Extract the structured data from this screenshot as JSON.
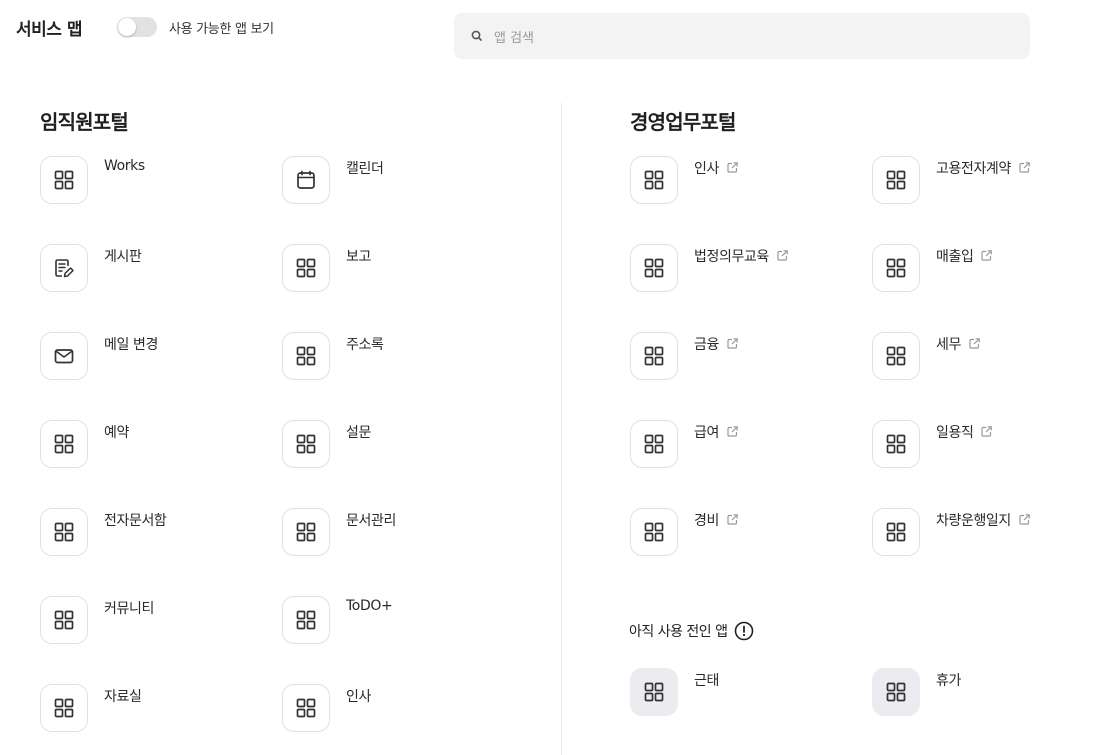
{
  "header": {
    "title": "서비스 맵",
    "toggle_label": "사용 가능한 앱 보기",
    "toggle_on": false,
    "search_placeholder": "앱 검색"
  },
  "left_section": {
    "title": "임직원포털",
    "apps": [
      {
        "label": "Works",
        "icon": "grid-icon"
      },
      {
        "label": "캘린더",
        "icon": "calendar-icon"
      },
      {
        "label": "게시판",
        "icon": "board-edit-icon"
      },
      {
        "label": "보고",
        "icon": "grid-icon"
      },
      {
        "label": "메일 변경",
        "icon": "mail-icon"
      },
      {
        "label": "주소록",
        "icon": "grid-icon"
      },
      {
        "label": "예약",
        "icon": "grid-icon"
      },
      {
        "label": "설문",
        "icon": "grid-icon"
      },
      {
        "label": "전자문서함",
        "icon": "grid-icon"
      },
      {
        "label": "문서관리",
        "icon": "grid-icon"
      },
      {
        "label": "커뮤니티",
        "icon": "grid-icon"
      },
      {
        "label": "ToDO+",
        "icon": "grid-icon"
      },
      {
        "label": "자료실",
        "icon": "grid-icon"
      },
      {
        "label": "인사",
        "icon": "grid-icon"
      }
    ]
  },
  "right_section": {
    "title": "경영업무포털",
    "apps": [
      {
        "label": "인사",
        "icon": "grid-icon",
        "external": true
      },
      {
        "label": "고용전자계약",
        "icon": "grid-icon",
        "external": true
      },
      {
        "label": "법정의무교육",
        "icon": "grid-icon",
        "external": true
      },
      {
        "label": "매출입",
        "icon": "grid-icon",
        "external": true
      },
      {
        "label": "금융",
        "icon": "grid-icon",
        "external": true
      },
      {
        "label": "세무",
        "icon": "grid-icon",
        "external": true
      },
      {
        "label": "급여",
        "icon": "grid-icon",
        "external": true
      },
      {
        "label": "일용직",
        "icon": "grid-icon",
        "external": true
      },
      {
        "label": "경비",
        "icon": "grid-icon",
        "external": true
      },
      {
        "label": "차량운행일지",
        "icon": "grid-icon",
        "external": true
      }
    ]
  },
  "not_yet": {
    "title": "아직 사용 전인 앱",
    "icon": "info-icon",
    "apps": [
      {
        "label": "근태",
        "icon": "grid-icon"
      },
      {
        "label": "휴가",
        "icon": "grid-icon"
      }
    ]
  },
  "colors": {
    "text": "#222222",
    "icon_border": "#e1e1e1",
    "disabled_bg": "#ececf0",
    "search_bg": "#f3f3f3"
  }
}
